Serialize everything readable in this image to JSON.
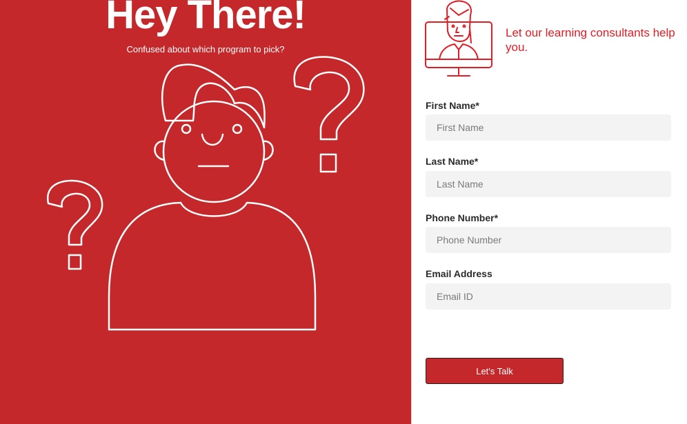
{
  "hero": {
    "title": "Hey There!",
    "subtitle": "Confused about which program to pick?"
  },
  "panel": {
    "tagline": "Let our learning consultants help you."
  },
  "form": {
    "first_name": {
      "label": "First Name*",
      "placeholder": "First Name",
      "value": ""
    },
    "last_name": {
      "label": "Last Name*",
      "placeholder": "Last Name",
      "value": ""
    },
    "phone": {
      "label": "Phone Number*",
      "placeholder": "Phone Number",
      "value": ""
    },
    "email": {
      "label": "Email Address",
      "placeholder": "Email ID",
      "value": ""
    },
    "submit_label": "Let's Talk"
  },
  "colors": {
    "brand_red": "#c4282a",
    "accent_red": "#e31b23",
    "field_bg": "#f3f3f3"
  },
  "icons": {
    "hero_illustration": "confused-person-icon",
    "question_marks": "question-mark-icon",
    "consultant": "consultant-monitor-icon"
  }
}
